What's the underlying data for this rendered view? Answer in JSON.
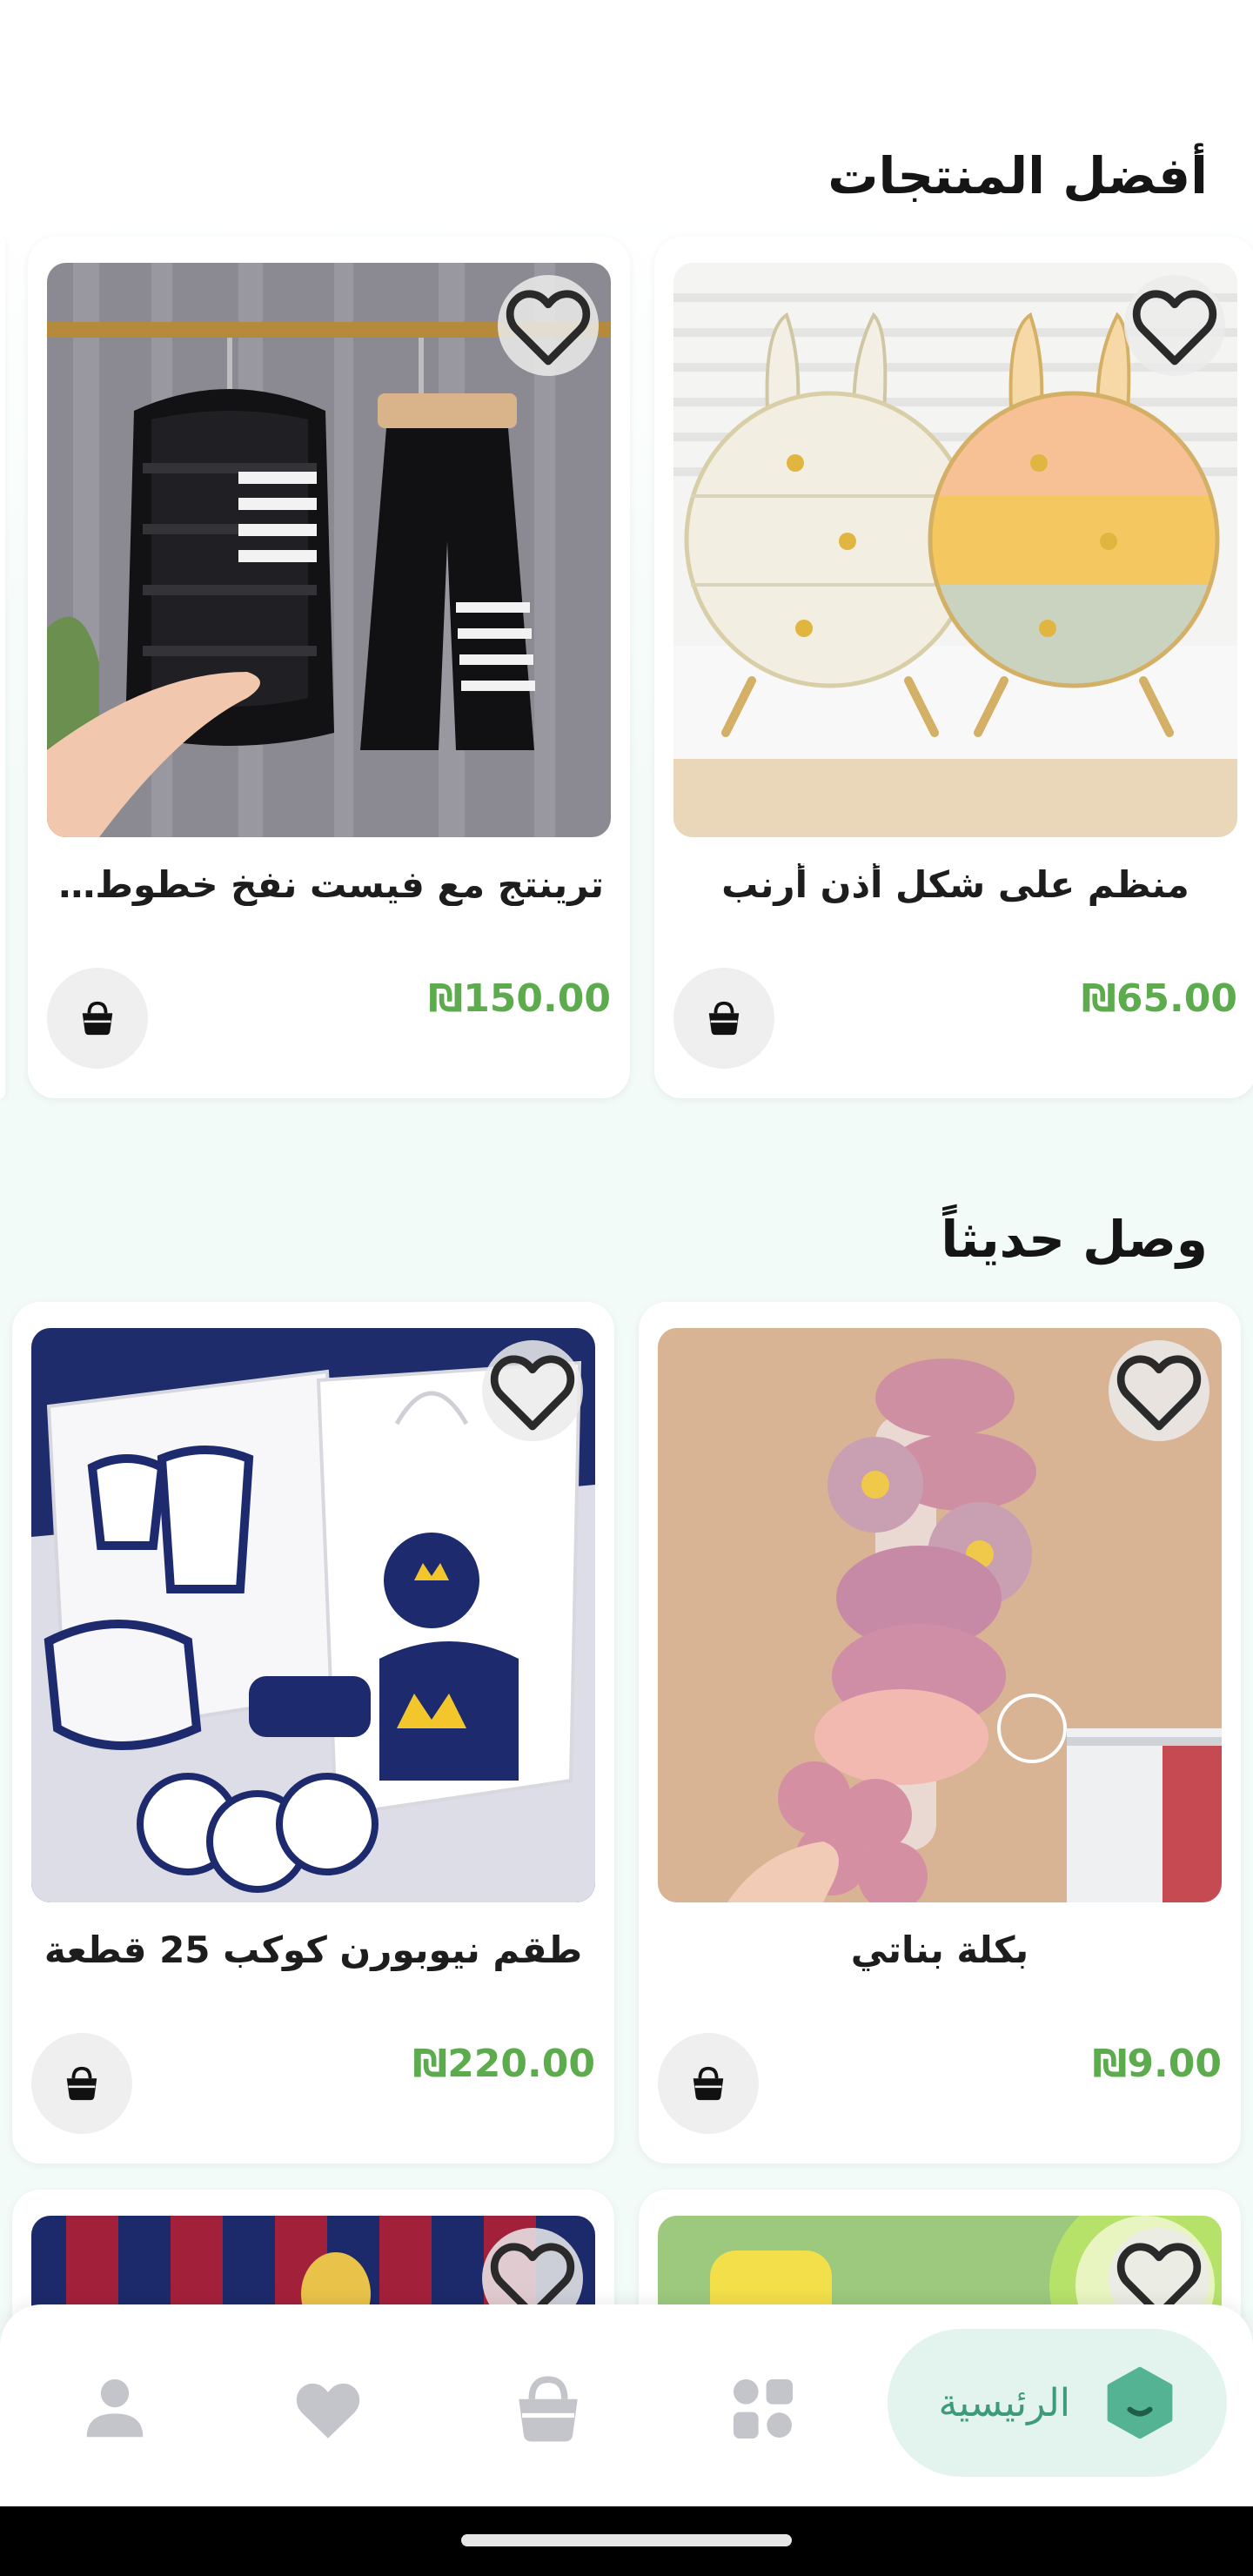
{
  "sections": {
    "best_products": {
      "title": "أفضل المنتجات",
      "products": [
        {
          "name": "منظم على شكل أذن أرنب",
          "price": "₪65.00"
        },
        {
          "name": "ترينتج مع فيست نفخ خطوط عر...",
          "price": "₪150.00"
        }
      ]
    },
    "new_arrivals": {
      "title": "وصل حديثاً",
      "products": [
        {
          "name": "بكلة بناتي",
          "price": "₪9.00"
        },
        {
          "name": "طقم نيوبورن كوكب 25 قطعة",
          "price": "₪220.00"
        }
      ]
    }
  },
  "bottom_nav": {
    "items": [
      {
        "label": "الرئيسية",
        "icon": "home-icon",
        "active": true
      },
      {
        "label": "",
        "icon": "categories-icon",
        "active": false
      },
      {
        "label": "",
        "icon": "basket-icon",
        "active": false
      },
      {
        "label": "",
        "icon": "heart-icon",
        "active": false
      },
      {
        "label": "",
        "icon": "profile-icon",
        "active": false
      }
    ]
  },
  "colors": {
    "price": "#5cab4d",
    "accent": "#3e9a7d",
    "active_nav_bg": "#e3f4ee",
    "inactive_icon": "#c3c5ca"
  }
}
